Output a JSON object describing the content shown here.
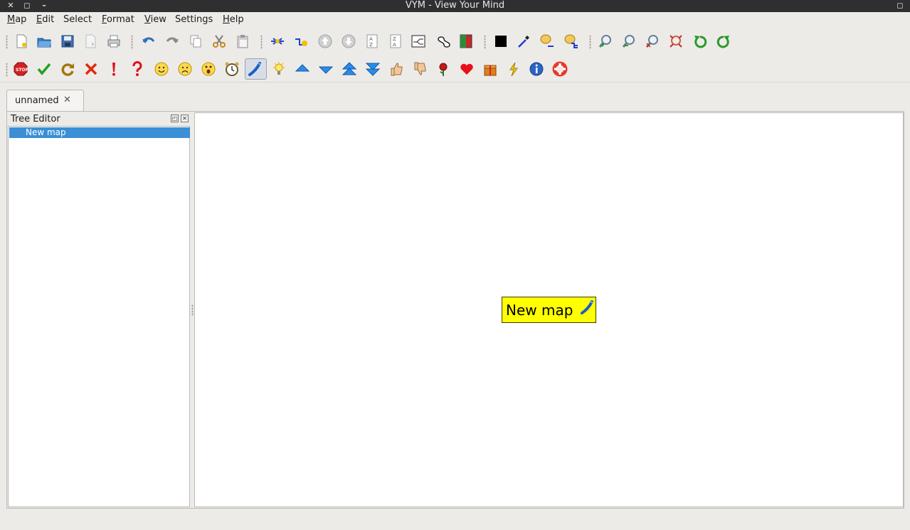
{
  "window": {
    "title": "VYM - View Your Mind"
  },
  "menubar": {
    "items": [
      {
        "label": "Map",
        "mnemonic": "M",
        "rest": "ap"
      },
      {
        "label": "Edit",
        "mnemonic": "E",
        "rest": "dit"
      },
      {
        "label": "Select",
        "mnemonic": "",
        "rest": "Select"
      },
      {
        "label": "Format",
        "mnemonic": "F",
        "rest": "ormat"
      },
      {
        "label": "View",
        "mnemonic": "V",
        "rest": "iew"
      },
      {
        "label": "Settings",
        "mnemonic": "",
        "rest": "Settings"
      },
      {
        "label": "Help",
        "mnemonic": "H",
        "rest": "elp"
      }
    ]
  },
  "toolbar1": {
    "icons": [
      "new-map-icon",
      "open-map-icon",
      "save-map-icon",
      "save-as-icon",
      "print-icon",
      "undo-icon",
      "redo-icon",
      "copy-icon",
      "cut-icon",
      "paste-icon",
      "add-branch-icon",
      "add-branch-before-icon",
      "move-up-icon",
      "move-down-icon",
      "sort-ascending-icon",
      "sort-descending-icon",
      "toggle-scroll-icon",
      "add-xlink-icon",
      "toggle-hide-icon",
      "color-black-icon",
      "pick-color-icon",
      "format-color-branch-icon",
      "format-color-subtree-icon",
      "zoom-in-icon",
      "zoom-out-icon",
      "zoom-reset-icon",
      "zoom-fit-icon",
      "rotate-left-icon",
      "rotate-right-icon"
    ]
  },
  "toolbar2": {
    "icons": [
      "stop-flag-icon",
      "ok-flag-icon",
      "recurring-flag-icon",
      "cross-flag-icon",
      "important-flag-icon",
      "question-flag-icon",
      "smiley-good-icon",
      "smiley-bad-icon",
      "smiley-omg-icon",
      "clock-flag-icon",
      "phone-flag-icon",
      "lamp-flag-icon",
      "arrow-up-flag-icon",
      "arrow-down-flag-icon",
      "double-arrow-up-flag-icon",
      "double-arrow-down-flag-icon",
      "thumb-up-flag-icon",
      "thumb-down-flag-icon",
      "rose-flag-icon",
      "heart-flag-icon",
      "present-flag-icon",
      "flash-flag-icon",
      "info-flag-icon",
      "lifebelt-flag-icon"
    ]
  },
  "tabs": [
    {
      "label": "unnamed",
      "close": "✕"
    }
  ],
  "tree_editor": {
    "title": "Tree Editor",
    "rows": [
      {
        "label": "New map",
        "selected": true
      }
    ]
  },
  "map": {
    "central_node": {
      "label": "New map",
      "bg_color": "#ffff00"
    }
  },
  "colors": {
    "selection": "#3a8fd6",
    "titlebar": "#2f2f2f",
    "node": "#ffff00"
  }
}
